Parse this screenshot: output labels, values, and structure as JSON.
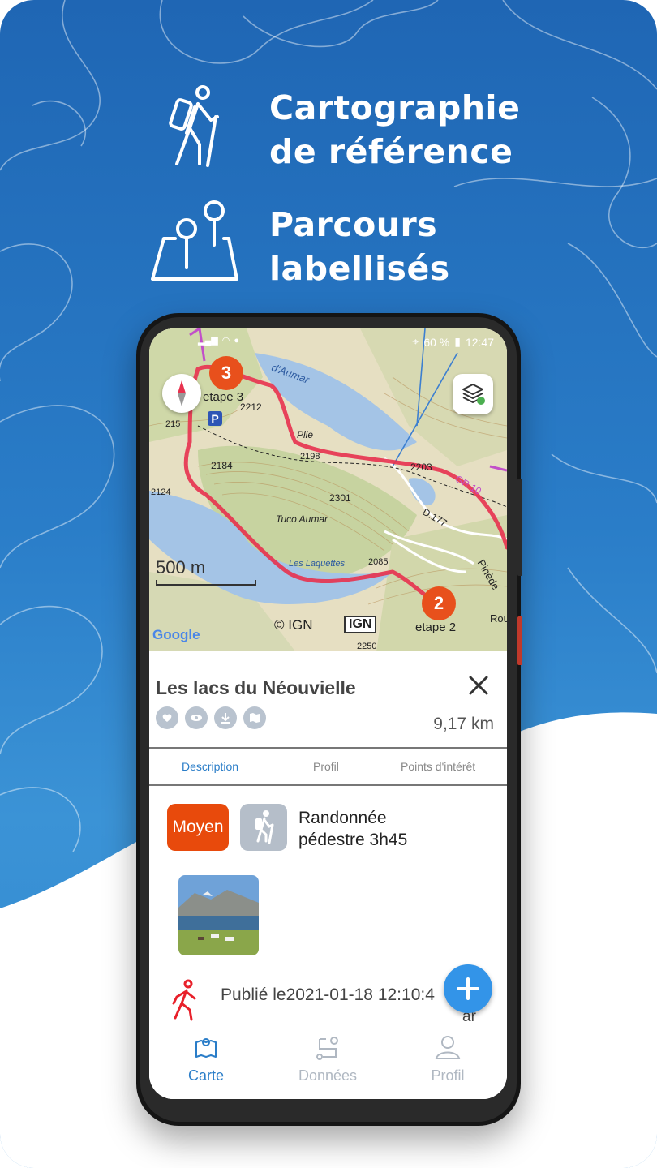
{
  "promo": {
    "line1a": "Cartographie",
    "line1b": "de référence",
    "line2a": "Parcours",
    "line2b": "labellisés"
  },
  "status": {
    "battery": "60 %",
    "time": "12:47"
  },
  "map": {
    "scale": "500 m",
    "attribution": "© IGN",
    "ign_logo": "IGN",
    "google_logo": "Google",
    "markers": [
      {
        "number": "3",
        "label": "etape 3"
      },
      {
        "number": "2",
        "label": "etape 2"
      }
    ],
    "labels": {
      "elev1": "2212",
      "elev2": "2184",
      "elev3": "2198",
      "elev4": "2301",
      "elev5": "2203",
      "elev6": "2085",
      "elev7": "2250",
      "elev8": "2124",
      "elev9": "215",
      "place1": "Plle",
      "place2": "Tuco Aumar",
      "place3": "Les Laquettes",
      "road": "D.177",
      "trail": "GR 10",
      "aumar": "d'Aumar",
      "pinede": "Pinède",
      "rou": "Rou",
      "parking": "P"
    }
  },
  "route": {
    "title": "Les lacs du Néouvielle",
    "distance": "9,17 km",
    "tabs": [
      "Description",
      "Profil",
      "Points d'intérêt"
    ],
    "difficulty": "Moyen",
    "activity_line1": "Randonnée",
    "activity_line2": "pédestre 3h45",
    "published_label": "Publié le",
    "published_date": "2021-01-18 12:10:4",
    "published_suffix": "ar"
  },
  "nav": {
    "items": [
      {
        "label": "Carte",
        "icon": "map-icon"
      },
      {
        "label": "Données",
        "icon": "route-data-icon"
      },
      {
        "label": "Profil",
        "icon": "user-icon"
      }
    ]
  },
  "colors": {
    "brand_blue": "#2a7dc8",
    "route_red": "#e8324f",
    "marker_orange": "#e8501c",
    "difficulty": "#e84a0c",
    "fab": "#3394e8"
  }
}
